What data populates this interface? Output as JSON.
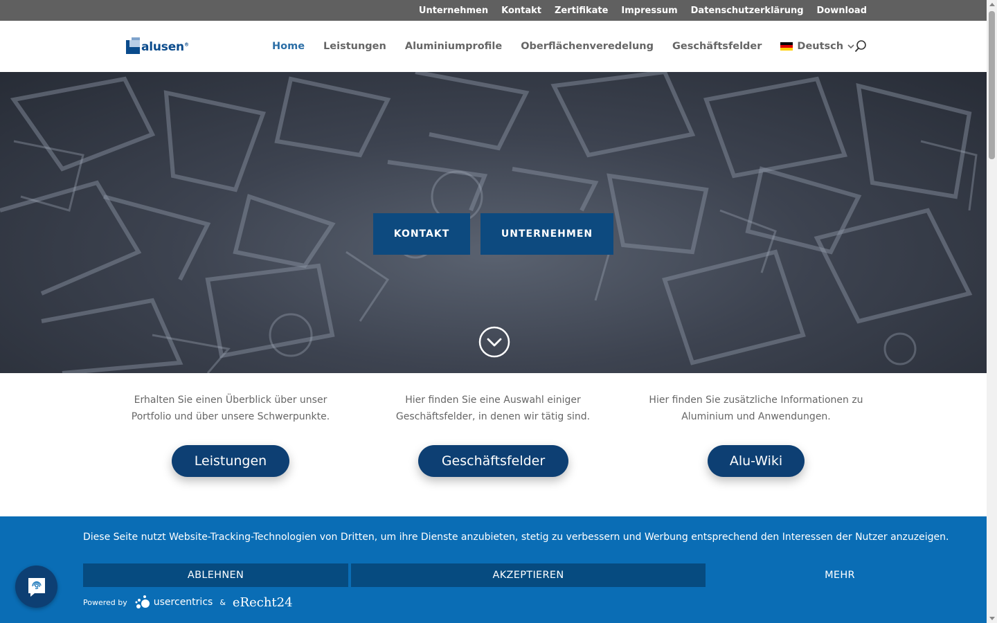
{
  "topbar": {
    "links": [
      "Unternehmen",
      "Kontakt",
      "Zertifikate",
      "Impressum",
      "Datenschutzerklärung",
      "Download"
    ]
  },
  "header": {
    "logo_text": "alusen",
    "logo_mark": "®",
    "nav": [
      {
        "label": "Home",
        "active": true
      },
      {
        "label": "Leistungen",
        "active": false
      },
      {
        "label": "Aluminiumprofile",
        "active": false
      },
      {
        "label": "Oberflächenveredelung",
        "active": false
      },
      {
        "label": "Geschäftsfelder",
        "active": false
      }
    ],
    "language": "Deutsch",
    "search_icon": "search-icon"
  },
  "hero": {
    "btn_kontakt": "KONTAKT",
    "btn_unternehmen": "UNTERNEHMEN",
    "scroll_icon": "chevron-down-circle-icon"
  },
  "features": [
    {
      "text": "Erhalten Sie einen Überblick über unser Portfolio und über unsere Schwerpunkte.",
      "button": "Leistungen"
    },
    {
      "text": "Hier finden Sie eine Auswahl einiger Geschäftsfelder, in denen wir tätig sind.",
      "button": "Geschäftsfelder"
    },
    {
      "text": "Hier finden Sie zusätzliche Informationen zu Aluminium und Anwendungen.",
      "button": "Alu-Wiki"
    }
  ],
  "cookie": {
    "text": "Diese Seite nutzt Website-Tracking-Technologien von Dritten, um ihre Dienste anzubieten, stetig zu verbessern und Werbung entsprechend den Interessen der Nutzer anzuzeigen.",
    "decline": "ABLEHNEN",
    "accept": "AKZEPTIEREN",
    "more": "MEHR",
    "powered_by": "Powered by",
    "brand_usercentrics": "usercentrics",
    "amp": "&",
    "brand_erecht": "eRecht24"
  },
  "colors": {
    "topbar": "#606060",
    "accent_blue": "#0d4a7f",
    "nav_active": "#2b6ea6",
    "cookie_bg": "#0a6db5"
  }
}
